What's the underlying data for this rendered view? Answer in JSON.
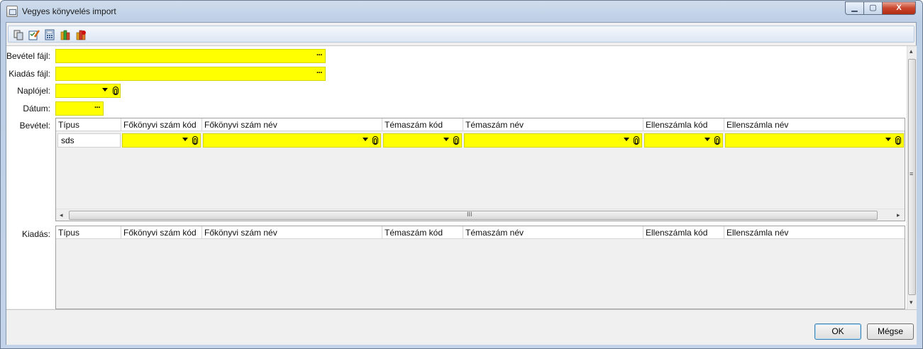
{
  "window": {
    "title": "Vegyes könyvelés import",
    "minimize": "▁",
    "maximize": "▢",
    "close": "X"
  },
  "toolbar": {
    "buttons": [
      {
        "icon": "copy-document-icon"
      },
      {
        "icon": "edit-checklist-icon"
      },
      {
        "icon": "calculator-icon"
      },
      {
        "icon": "book-stack-green-icon"
      },
      {
        "icon": "book-stack-red-icon"
      }
    ]
  },
  "form": {
    "bevetel_fajl_label": "Bevétel fájl:",
    "kiadas_fajl_label": "Kiadás fájl:",
    "naplojel_label": "Naplójel:",
    "datum_label": "Dátum:",
    "bevetel_label": "Bevétel:",
    "kiadas_label": "Kiadás:",
    "ellipsis": "···"
  },
  "columns": [
    "Típus",
    "Főkönyvi szám kód",
    "Főkönyvi szám név",
    "Témaszám kód",
    "Témaszám név",
    "Ellenszámla kód",
    "Ellenszámla név"
  ],
  "bevetel_rows": [
    {
      "tipus": "sds"
    }
  ],
  "scroll": {
    "h_thumb_mark": "III",
    "left_arrow": "◂",
    "right_arrow": "▸",
    "up_arrow": "▴",
    "down_arrow": "▾",
    "v_thumb_mark": "≡"
  },
  "buttons": {
    "ok": "OK",
    "cancel": "Mégse"
  },
  "colors": {
    "field_yellow": "#ffff00",
    "title_bar": "#c3d4ea",
    "close_red": "#c9452b"
  }
}
